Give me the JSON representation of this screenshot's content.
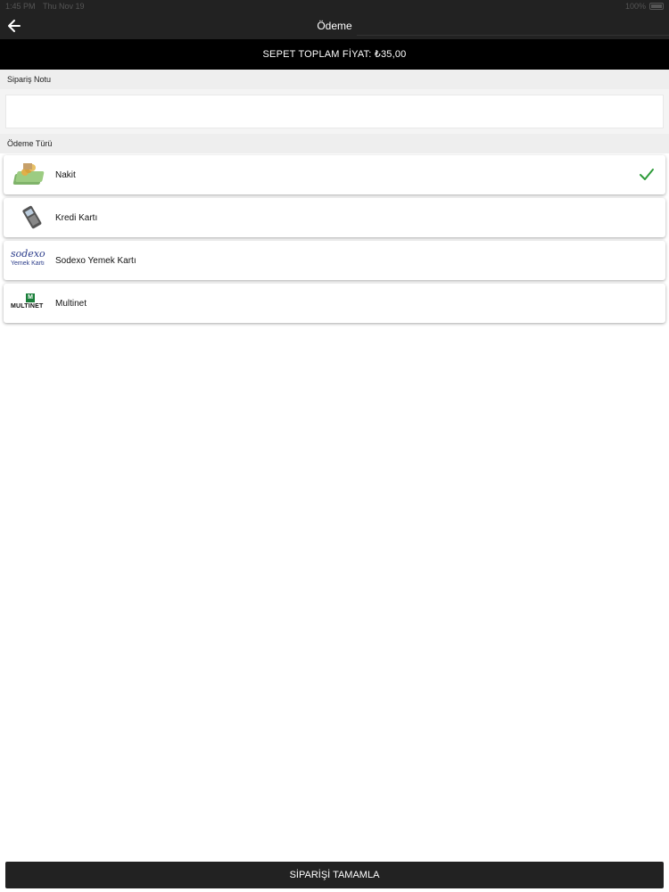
{
  "status_bar": {
    "time": "1:45 PM",
    "date": "Thu Nov 19",
    "battery": "100%"
  },
  "navbar": {
    "title": "Ödeme"
  },
  "total": {
    "text": "SEPET TOPLAM FİYAT: ₺35,00"
  },
  "order_note": {
    "label": "Sipariş Notu",
    "value": ""
  },
  "payment_type": {
    "label": "Ödeme Türü",
    "options": [
      {
        "label": "Nakit",
        "icon": "cash-icon",
        "selected": true
      },
      {
        "label": "Kredi Kartı",
        "icon": "card-terminal-icon",
        "selected": false
      },
      {
        "label": "Sodexo Yemek Kartı",
        "icon": "sodexo-logo",
        "selected": false
      },
      {
        "label": "Multinet",
        "icon": "multinet-logo",
        "selected": false
      }
    ]
  },
  "logos": {
    "sodexo_top": "sodexo",
    "sodexo_bottom": "Yemek Kartı",
    "multinet_word": "MULTINET",
    "multinet_badge": "M"
  },
  "footer": {
    "button_label": "SİPARİŞİ TAMAMLA"
  },
  "colors": {
    "navbar": "#222222",
    "total_bar": "#000000",
    "check": "#2e9b3a",
    "section_bg": "#eeeeee"
  }
}
